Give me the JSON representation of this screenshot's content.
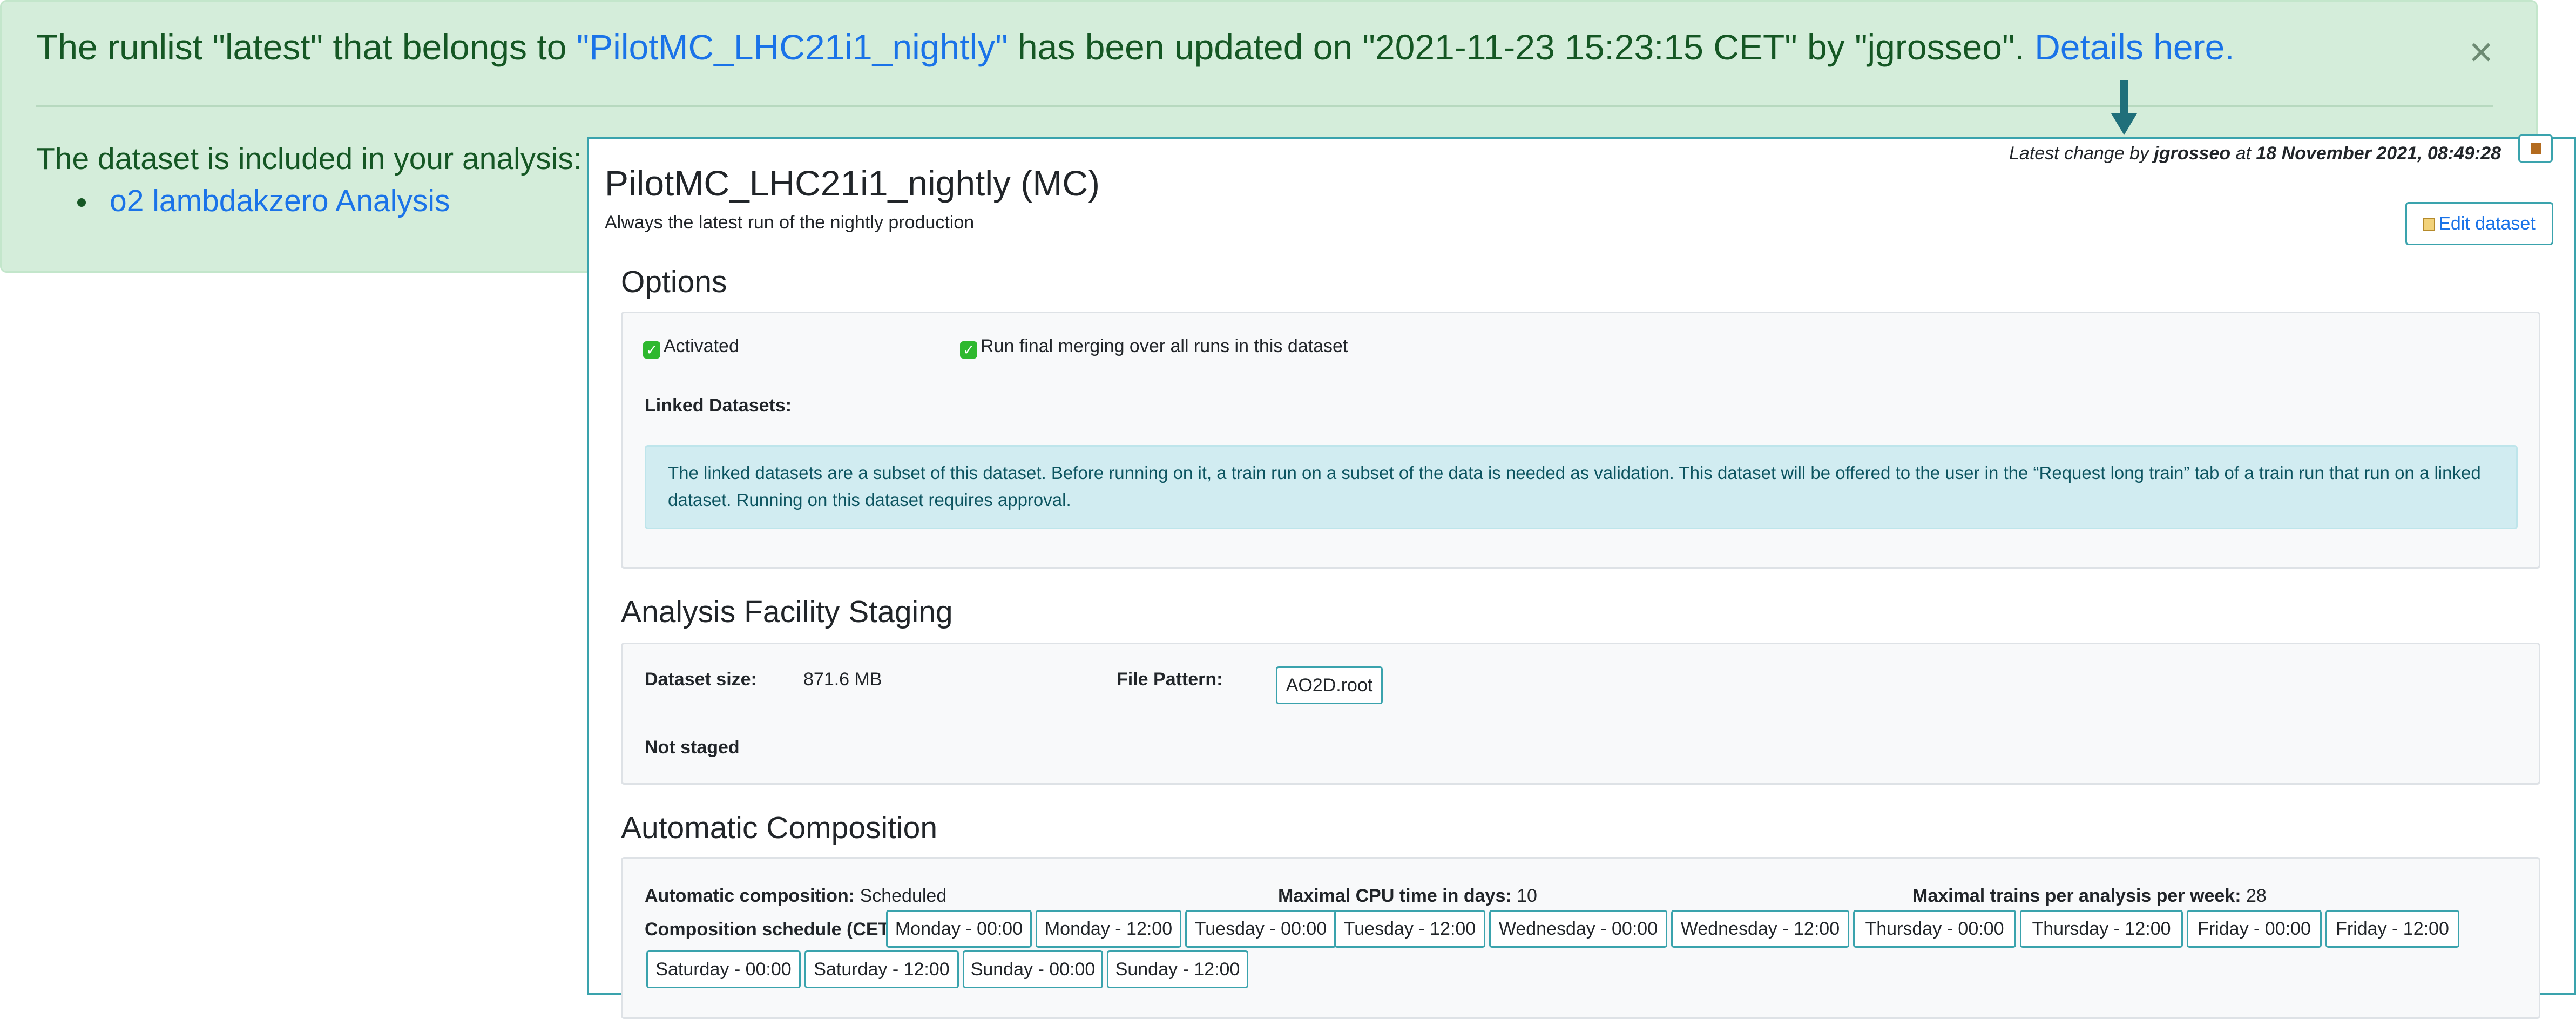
{
  "alert": {
    "prefix": "The runlist \"latest\" that belongs to ",
    "dataset_link": "\"PilotMC_LHC21i1_nightly\"",
    "suffix": " has been updated on \"2021-11-23 15:23:15 CET\" by \"jgrosseo\". ",
    "details_link": "Details here.",
    "close": "×",
    "included_text": "The dataset is included in your analysis:",
    "analyses": [
      "o2 lambdakzero Analysis"
    ]
  },
  "dataset": {
    "latest_change_prefix": "Latest change by ",
    "latest_change_user": "jgrosseo",
    "latest_change_at": " at ",
    "latest_change_date": "18 November 2021, 08:49:28",
    "title": "PilotMC_LHC21i1_nightly (MC)",
    "subtitle": "Always the latest run of the nightly production",
    "edit_button": "Edit dataset",
    "history_icon": "history-icon"
  },
  "options": {
    "heading": "Options",
    "activated": "Activated",
    "final_merging": "Run final merging over all runs in this dataset",
    "linked_label": "Linked Datasets:",
    "linked_info": "The linked datasets are a subset of this dataset. Before running on it, a train run on a subset of the data is needed as validation. This dataset will be offered to the user in the “Request long train” tab of a train run that run on a linked dataset. Running on this dataset requires approval."
  },
  "staging": {
    "heading": "Analysis Facility Staging",
    "size_label": "Dataset size:",
    "size_value": "871.6 MB",
    "pattern_label": "File Pattern:",
    "pattern_value": "AO2D.root",
    "status": "Not staged"
  },
  "composition": {
    "heading": "Automatic Composition",
    "auto_label": "Automatic composition:",
    "auto_value": " Scheduled",
    "cpu_label": "Maximal CPU time in days:",
    "cpu_value": " 10",
    "trains_label": "Maximal trains per analysis per week:",
    "trains_value": " 28",
    "schedule_label": "Composition schedule (CET):",
    "schedule": [
      "Monday - 00:00",
      "Monday - 12:00",
      "Tuesday - 00:00",
      "Tuesday - 12:00",
      "Wednesday - 00:00",
      "Wednesday - 12:00",
      "Thursday - 00:00",
      "Thursday - 12:00",
      "Friday - 00:00",
      "Friday - 12:00",
      "Saturday - 00:00",
      "Saturday - 12:00",
      "Sunday - 00:00",
      "Sunday - 12:00"
    ]
  },
  "colors": {
    "alert_bg": "#d4edda",
    "alert_text": "#155724",
    "link": "#1a73e8",
    "panel_border": "#3aa3ad",
    "info_bg": "#d1ecf1",
    "check": "#2eb82e"
  }
}
